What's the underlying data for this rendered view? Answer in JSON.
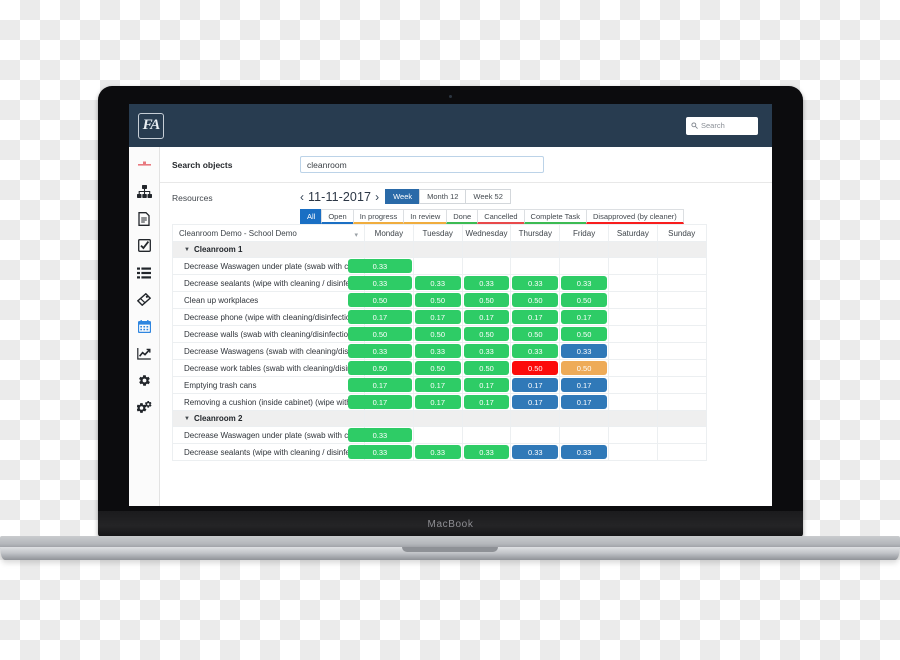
{
  "device": {
    "label": "MacBook"
  },
  "topbar": {
    "logo_text": "FA",
    "search_placeholder": "Search",
    "search_icon": "search-icon"
  },
  "sidebar": {
    "items": [
      {
        "icon": "toolbar-handle-icon",
        "label": ""
      },
      {
        "icon": "sitemap-icon",
        "label": ""
      },
      {
        "icon": "document-icon",
        "label": ""
      },
      {
        "icon": "checkbox-checked-icon",
        "label": ""
      },
      {
        "icon": "list-icon",
        "label": ""
      },
      {
        "icon": "tag-icon",
        "label": ""
      },
      {
        "icon": "calendar-icon",
        "label": ""
      },
      {
        "icon": "chart-line-icon",
        "label": ""
      },
      {
        "icon": "gear-icon",
        "label": ""
      },
      {
        "icon": "gears-icon",
        "label": ""
      }
    ]
  },
  "search_objects": {
    "label": "Search objects",
    "value": "cleanroom",
    "placeholder": ""
  },
  "resources": {
    "label": "Resources"
  },
  "calendar": {
    "prev_icon": "chevron-left-icon",
    "next_icon": "chevron-right-icon",
    "date": "11-11-2017",
    "range_buttons": [
      {
        "label": "Week",
        "active": true
      },
      {
        "label": "Month 12",
        "active": false
      },
      {
        "label": "Week 52",
        "active": false
      }
    ],
    "filters": [
      {
        "label": "All",
        "active": true,
        "color": "#1a6fc4"
      },
      {
        "label": "Open",
        "active": false,
        "color": "#1a6fc4"
      },
      {
        "label": "In progress",
        "active": false,
        "color": "#f0ad3e"
      },
      {
        "label": "In review",
        "active": false,
        "color": "#f0ad3e"
      },
      {
        "label": "Done",
        "active": false,
        "color": "#3cbb53"
      },
      {
        "label": "Cancelled",
        "active": false,
        "color": "#e8494b"
      },
      {
        "label": "Complete Task",
        "active": false,
        "color": "#3cbb53"
      },
      {
        "label": "Disapproved (by cleaner)",
        "active": false,
        "color": "#f81d1d"
      }
    ]
  },
  "table": {
    "name_header": "Cleanroom Demo - School Demo",
    "name_header_caret": "chevron-down-icon",
    "day_headers": [
      "Monday",
      "Tuesday",
      "Wednesday",
      "Thursday",
      "Friday",
      "Saturday",
      "Sunday"
    ],
    "groups": [
      {
        "name": "Cleanroom 1",
        "expanded": true,
        "rows": [
          {
            "task": "Decrease Waswagen under plate (swab with cleaning/disinfection)",
            "cells": [
              {
                "value": "0.33",
                "color": "green"
              },
              null,
              null,
              null,
              null,
              null,
              null
            ]
          },
          {
            "task": "Decrease sealants (wipe with cleaning / disinfection)",
            "cells": [
              {
                "value": "0.33",
                "color": "green"
              },
              {
                "value": "0.33",
                "color": "green"
              },
              {
                "value": "0.33",
                "color": "green"
              },
              {
                "value": "0.33",
                "color": "green"
              },
              {
                "value": "0.33",
                "color": "green"
              },
              null,
              null
            ]
          },
          {
            "task": "Clean up workplaces",
            "cells": [
              {
                "value": "0.50",
                "color": "green"
              },
              {
                "value": "0.50",
                "color": "green"
              },
              {
                "value": "0.50",
                "color": "green"
              },
              {
                "value": "0.50",
                "color": "green"
              },
              {
                "value": "0.50",
                "color": "green"
              },
              null,
              null
            ]
          },
          {
            "task": "Decrease phone (wipe with cleaning/disinfection)",
            "cells": [
              {
                "value": "0.17",
                "color": "green"
              },
              {
                "value": "0.17",
                "color": "green"
              },
              {
                "value": "0.17",
                "color": "green"
              },
              {
                "value": "0.17",
                "color": "green"
              },
              {
                "value": "0.17",
                "color": "green"
              },
              null,
              null
            ]
          },
          {
            "task": "Decrease walls (swab with cleaning/disinfection)",
            "cells": [
              {
                "value": "0.50",
                "color": "green"
              },
              {
                "value": "0.50",
                "color": "green"
              },
              {
                "value": "0.50",
                "color": "green"
              },
              {
                "value": "0.50",
                "color": "green"
              },
              {
                "value": "0.50",
                "color": "green"
              },
              null,
              null
            ]
          },
          {
            "task": "Decrease Waswagens (swab with cleaning/disinfection)",
            "cells": [
              {
                "value": "0.33",
                "color": "green"
              },
              {
                "value": "0.33",
                "color": "green"
              },
              {
                "value": "0.33",
                "color": "green"
              },
              {
                "value": "0.33",
                "color": "green"
              },
              {
                "value": "0.33",
                "color": "blue"
              },
              null,
              null
            ]
          },
          {
            "task": "Decrease work tables (swab with cleaning/disinfection)",
            "cells": [
              {
                "value": "0.50",
                "color": "green"
              },
              {
                "value": "0.50",
                "color": "green"
              },
              {
                "value": "0.50",
                "color": "green"
              },
              {
                "value": "0.50",
                "color": "red"
              },
              {
                "value": "0.50",
                "color": "orange"
              },
              null,
              null
            ]
          },
          {
            "task": "Emptying trash cans",
            "cells": [
              {
                "value": "0.17",
                "color": "green"
              },
              {
                "value": "0.17",
                "color": "green"
              },
              {
                "value": "0.17",
                "color": "green"
              },
              {
                "value": "0.17",
                "color": "blue"
              },
              {
                "value": "0.17",
                "color": "blue"
              },
              null,
              null
            ]
          },
          {
            "task": "Removing a cushion (inside cabinet) (wipe with cleaning/disinfection)",
            "cells": [
              {
                "value": "0.17",
                "color": "green"
              },
              {
                "value": "0.17",
                "color": "green"
              },
              {
                "value": "0.17",
                "color": "green"
              },
              {
                "value": "0.17",
                "color": "blue"
              },
              {
                "value": "0.17",
                "color": "blue"
              },
              null,
              null
            ]
          }
        ]
      },
      {
        "name": "Cleanroom 2",
        "expanded": true,
        "rows": [
          {
            "task": "Decrease Waswagen under plate (swab with cleaning/disinfection)",
            "cells": [
              {
                "value": "0.33",
                "color": "green"
              },
              null,
              null,
              null,
              null,
              null,
              null
            ]
          },
          {
            "task": "Decrease sealants (wipe with cleaning / disinfection)",
            "cells": [
              {
                "value": "0.33",
                "color": "green"
              },
              {
                "value": "0.33",
                "color": "green"
              },
              {
                "value": "0.33",
                "color": "green"
              },
              {
                "value": "0.33",
                "color": "blue"
              },
              {
                "value": "0.33",
                "color": "blue"
              },
              null,
              null
            ]
          }
        ]
      }
    ]
  },
  "colors": {
    "navy": "#283c50",
    "green": "#2ecc66",
    "blue": "#3079b8",
    "red": "#fc0b0b",
    "orange": "#eeab58",
    "accent_blue": "#1a6fc4"
  }
}
